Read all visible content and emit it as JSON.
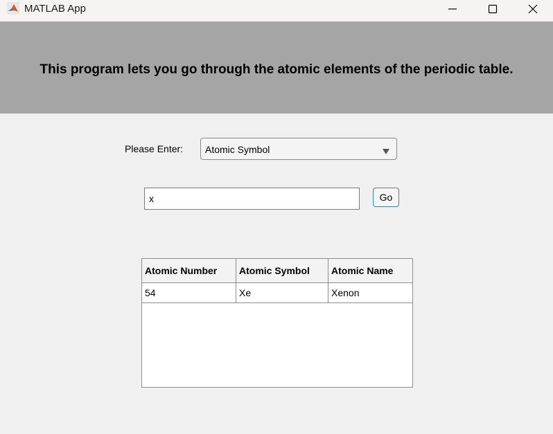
{
  "window": {
    "title": "MATLAB App",
    "icon": "matlab-logo-icon",
    "controls": [
      "minimize-icon",
      "maximize-icon",
      "close-icon"
    ]
  },
  "header": {
    "text": "This program lets you go through the atomic elements of the periodic table.",
    "background": "#a5a5a5"
  },
  "form": {
    "enter_label": "Please Enter:",
    "dropdown_value": "Atomic Symbol",
    "input_value": "x",
    "go_label": "Go"
  },
  "table": {
    "columns": [
      "Atomic Number",
      "Atomic Symbol",
      "Atomic Name"
    ],
    "rows": [
      [
        "54",
        "Xe",
        "Xenon"
      ]
    ]
  },
  "colors": {
    "accent_button_border": "#3c84c6",
    "window_background": "#f0f0f0"
  }
}
